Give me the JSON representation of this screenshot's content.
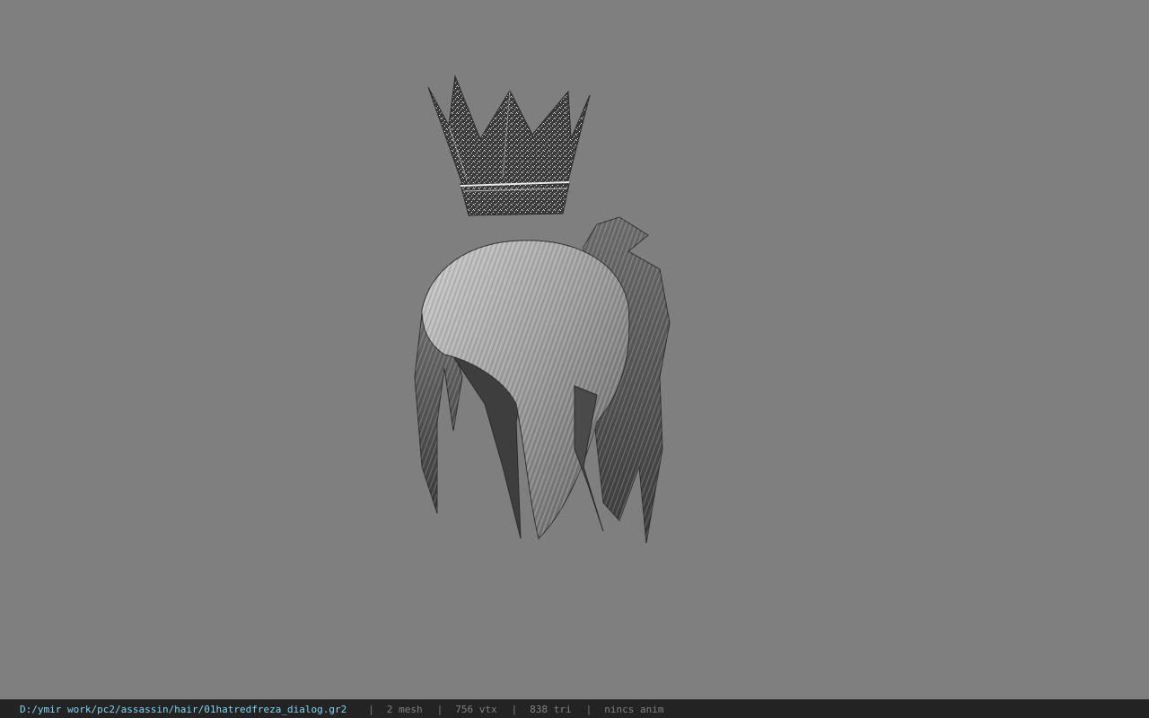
{
  "viewport": {
    "background": "#7f7f7f",
    "model": {
      "crown": "crown-mesh",
      "hair": "hair-mesh"
    }
  },
  "status_bar": {
    "file_path": "D:/ymir work/pc2/assassin/hair/01hatredfreza_dialog.gr2",
    "separator": "|",
    "mesh_count": "2 mesh",
    "vertex_count": "756 vtx",
    "triangle_count": "838 tri",
    "anim_status": "nincs anim",
    "path_color": "#7fd3f0",
    "text_color": "#808080"
  }
}
